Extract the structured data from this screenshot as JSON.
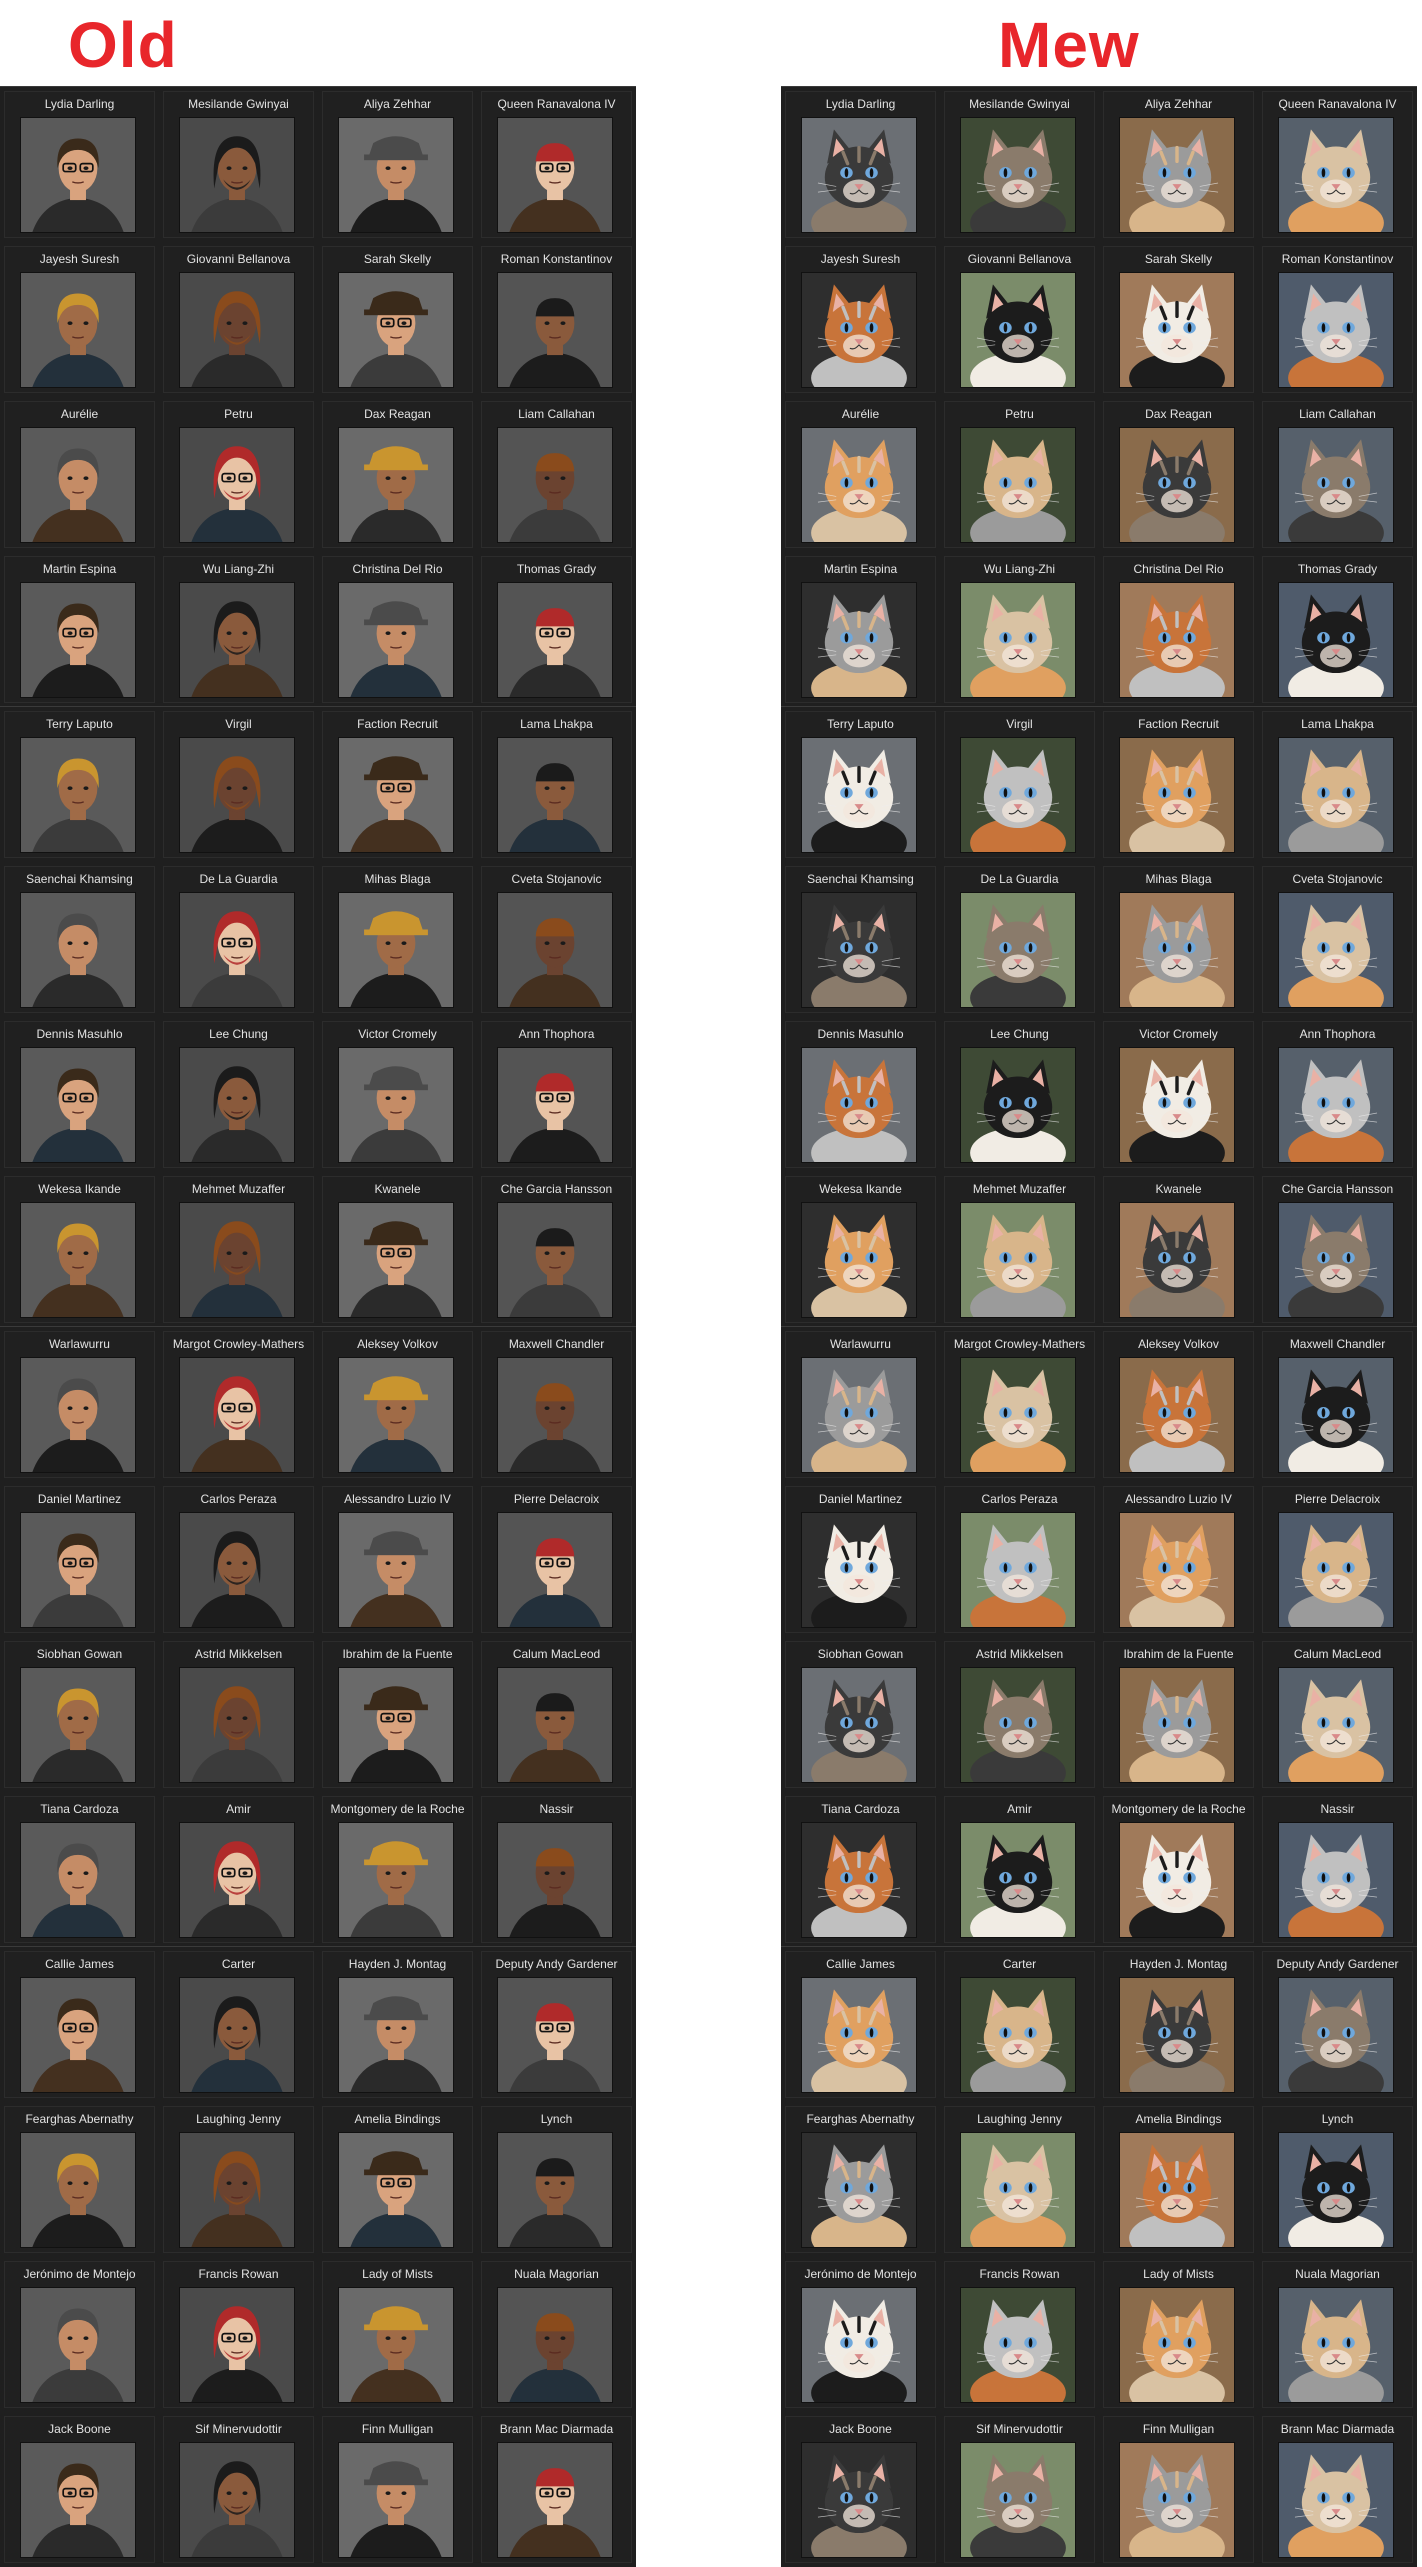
{
  "headers": {
    "old": "Old",
    "new": "Mew"
  },
  "old_rows": [
    [
      "Lydia Darling",
      "Mesilande Gwinyai",
      "Aliya Zehhar",
      "Queen Ranavalona IV"
    ],
    [
      "Jayesh Suresh",
      "Giovanni Bellanova",
      "Sarah Skelly",
      "Roman Konstantinov"
    ],
    [
      "Aurélie",
      "Petru",
      "Dax Reagan",
      "Liam Callahan"
    ],
    [
      "Martin Espina",
      "Wu Liang-Zhi",
      "Christina Del Rio",
      "Thomas Grady"
    ],
    [
      "Terry Laputo",
      "Virgil",
      "Faction Recruit",
      "Lama Lhakpa"
    ],
    [
      "Saenchai Khamsing",
      "De La Guardia",
      "Mihas Blaga",
      "Cveta Stojanovic"
    ],
    [
      "Dennis Masuhlo",
      "Lee Chung",
      "Victor Cromely",
      "Ann Thophora"
    ],
    [
      "Wekesa Ikande",
      "Mehmet Muzaffer",
      "Kwanele",
      "Che Garcia Hansson"
    ],
    [
      "Warlawurru",
      "Margot Crowley-Mathers",
      "Aleksey Volkov",
      "Maxwell Chandler"
    ],
    [
      "Daniel Martinez",
      "Carlos Peraza",
      "Alessandro Luzio IV",
      "Pierre Delacroix"
    ],
    [
      "Siobhan Gowan",
      "Astrid Mikkelsen",
      "Ibrahim de la Fuente",
      "Calum MacLeod"
    ],
    [
      "Tiana Cardoza",
      "Amir",
      "Montgomery de la Roche",
      "Nassir"
    ],
    [
      "Callie James",
      "Carter",
      "Hayden J. Montag",
      "Deputy Andy Gardener"
    ],
    [
      "Fearghas Abernathy",
      "Laughing Jenny",
      "Amelia Bindings",
      "Lynch"
    ],
    [
      "Jerónimo de Montejo",
      "Francis Rowan",
      "Lady of Mists",
      "Nuala Magorian"
    ],
    [
      "Jack Boone",
      "Sif Minervudottir",
      "Finn Mulligan",
      "Brann Mac Diarmada"
    ]
  ],
  "new_rows": [
    [
      "Lydia Darling",
      "Mesilande Gwinyai",
      "Aliya Zehhar",
      "Queen Ranavalona IV"
    ],
    [
      "Jayesh Suresh",
      "Giovanni Bellanova",
      "Sarah Skelly",
      "Roman Konstantinov"
    ],
    [
      "Aurélie",
      "Petru",
      "Dax Reagan",
      "Liam Callahan"
    ],
    [
      "Martin Espina",
      "Wu Liang-Zhi",
      "Christina Del Rio",
      "Thomas Grady"
    ],
    [
      "Terry Laputo",
      "Virgil",
      "Faction Recruit",
      "Lama Lhakpa"
    ],
    [
      "Saenchai Khamsing",
      "De La Guardia",
      "Mihas Blaga",
      "Cveta Stojanovic"
    ],
    [
      "Dennis Masuhlo",
      "Lee Chung",
      "Victor Cromely",
      "Ann Thophora"
    ],
    [
      "Wekesa Ikande",
      "Mehmet Muzaffer",
      "Kwanele",
      "Che Garcia Hansson"
    ],
    [
      "Warlawurru",
      "Margot Crowley-Mathers",
      "Aleksey Volkov",
      "Maxwell Chandler"
    ],
    [
      "Daniel Martinez",
      "Carlos Peraza",
      "Alessandro Luzio IV",
      "Pierre Delacroix"
    ],
    [
      "Siobhan Gowan",
      "Astrid Mikkelsen",
      "Ibrahim de la Fuente",
      "Calum MacLeod"
    ],
    [
      "Tiana Cardoza",
      "Amir",
      "Montgomery de la Roche",
      "Nassir"
    ],
    [
      "Callie James",
      "Carter",
      "Hayden J. Montag",
      "Deputy Andy Gardener"
    ],
    [
      "Fearghas Abernathy",
      "Laughing Jenny",
      "Amelia Bindings",
      "Lynch"
    ],
    [
      "Jerónimo de Montejo",
      "Francis Rowan",
      "Lady of Mists",
      "Nuala Magorian"
    ],
    [
      "Jack Boone",
      "Sif Minervudottir",
      "Finn Mulligan",
      "Brann Mac Diarmada"
    ]
  ],
  "colors": {
    "header": "#e8262b",
    "panel": "#1a1a1a",
    "name_text": "#e3e3e3",
    "old_bg": [
      "#5a5a5a",
      "#4a4a4a",
      "#6a6a6a",
      "#545454"
    ],
    "old_skin": [
      "#e8c3a5",
      "#a06b47",
      "#6b4330",
      "#d9a37e",
      "#8a5a3c",
      "#c58c66"
    ],
    "old_hair": [
      "#1b1b1b",
      "#3a2a1a",
      "#8a4b1c",
      "#c9952f",
      "#b02a2a",
      "#4b4b4b"
    ],
    "new_bg": [
      "#6b6f74",
      "#3e4a35",
      "#8a6b4b",
      "#56606b",
      "#2e2e2e",
      "#7b8c6a",
      "#a07a5a",
      "#4f5b6b"
    ],
    "new_fur": [
      "#f1ece4",
      "#d9c2a3",
      "#3a3a3a",
      "#c0c0c0",
      "#c8743a",
      "#8a7b6b",
      "#e0a060",
      "#1c1c1c",
      "#9b9b9b",
      "#d8b58a"
    ],
    "new_eyes": [
      "#6fa8dc",
      "#d9b24a",
      "#7bbf6a",
      "#e0a030",
      "#88b0d8"
    ]
  }
}
